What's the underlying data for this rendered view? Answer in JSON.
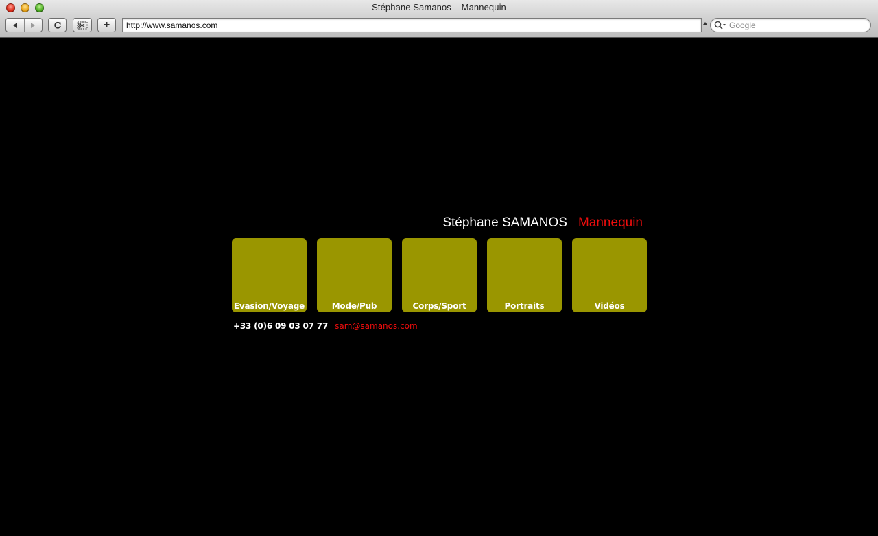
{
  "window": {
    "title": "Stéphane Samanos – Mannequin"
  },
  "toolbar": {
    "back_icon": "back-arrow-icon",
    "forward_icon": "forward-arrow-icon",
    "reload_icon": "reload-icon",
    "snippet_icon": "web-clip-icon",
    "add_icon": "plus-icon",
    "add_label": "+"
  },
  "address_bar": {
    "url": "http://www.samanos.com"
  },
  "search": {
    "placeholder": "Google"
  },
  "page": {
    "name": "Stéphane SAMANOS",
    "role": "Mannequin",
    "tiles": [
      {
        "label": "Evasion/Voyage"
      },
      {
        "label": "Mode/Pub"
      },
      {
        "label": "Corps/Sport"
      },
      {
        "label": "Portraits"
      },
      {
        "label": "Vidéos"
      }
    ],
    "phone": "+33 (0)6 09 03 07 77",
    "email": "sam@samanos.com"
  },
  "colors": {
    "background": "#000000",
    "tile": "#9a9600",
    "accent_red": "#ee0d0d",
    "text_white": "#ffffff"
  }
}
